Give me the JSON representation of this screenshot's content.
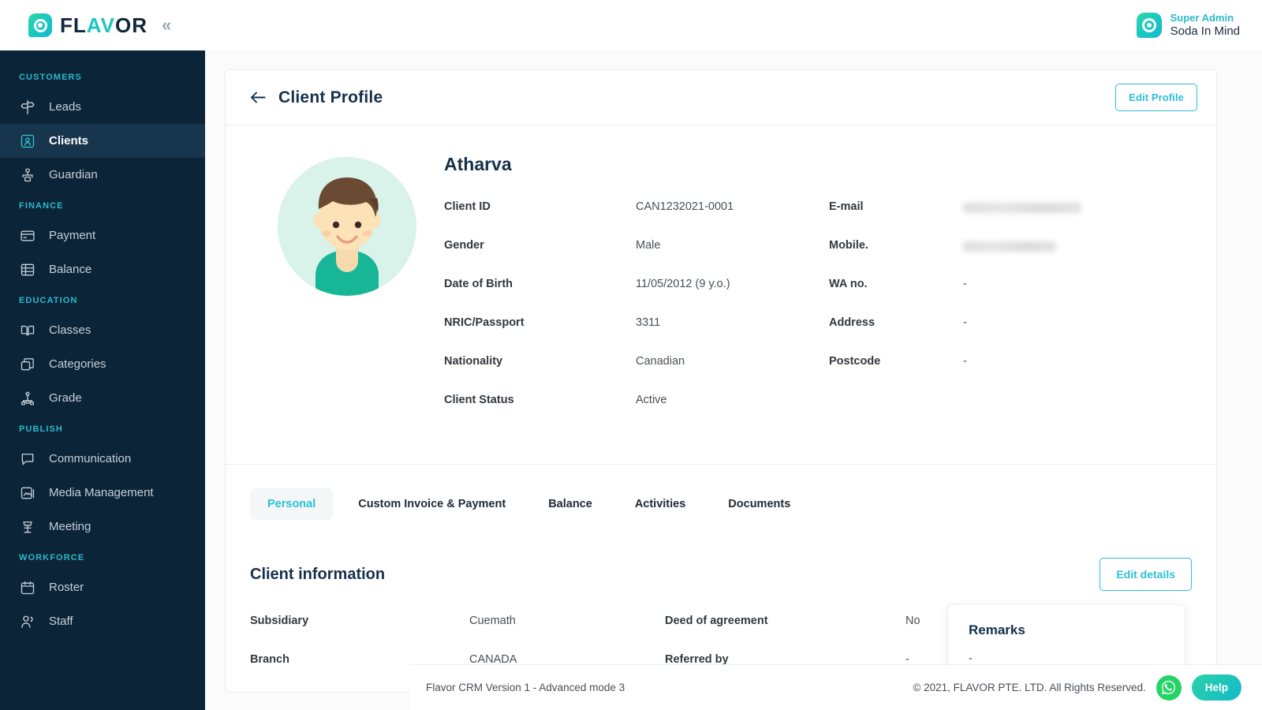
{
  "brand": {
    "logo_text_1": "FL",
    "logo_text_a": "A",
    "logo_text_v": "V",
    "logo_text_2": "OR",
    "collapse_icon": "«",
    "accent": "#2cc6d6",
    "sidebar_bg": "#0b2437",
    "active_bg": "#17354c"
  },
  "topbar": {
    "role": "Super Admin",
    "name": "Soda In Mind"
  },
  "sidebar": {
    "sections": [
      {
        "label": "CUSTOMERS",
        "items": [
          {
            "label": "Leads",
            "icon": "signpost-icon",
            "active": false
          },
          {
            "label": "Clients",
            "icon": "client-card-icon",
            "active": true
          },
          {
            "label": "Guardian",
            "icon": "guardian-icon",
            "active": false
          }
        ]
      },
      {
        "label": "FINANCE",
        "items": [
          {
            "label": "Payment",
            "icon": "credit-card-icon",
            "active": false
          },
          {
            "label": "Balance",
            "icon": "coins-stack-icon",
            "active": false
          }
        ]
      },
      {
        "label": "EDUCATION",
        "items": [
          {
            "label": "Classes",
            "icon": "open-book-icon",
            "active": false
          },
          {
            "label": "Categories",
            "icon": "boxes-icon",
            "active": false
          },
          {
            "label": "Grade",
            "icon": "hierarchy-icon",
            "active": false
          }
        ]
      },
      {
        "label": "PUBLISH",
        "items": [
          {
            "label": "Communication",
            "icon": "chat-bubble-icon",
            "active": false
          },
          {
            "label": "Media Management",
            "icon": "image-icon",
            "active": false
          },
          {
            "label": "Meeting",
            "icon": "podium-icon",
            "active": false
          }
        ]
      },
      {
        "label": "WORKFORCE",
        "items": [
          {
            "label": "Roster",
            "icon": "calendar-icon",
            "active": false
          },
          {
            "label": "Staff",
            "icon": "people-icon",
            "active": false
          }
        ]
      }
    ]
  },
  "page": {
    "title": "Client Profile",
    "back_icon": "arrow-left-icon",
    "edit_profile_label": "Edit Profile"
  },
  "client": {
    "name": "Atharva",
    "avatar": "boy-avatar",
    "left_fields": [
      {
        "label": "Client ID",
        "value": "CAN1232021-0001"
      },
      {
        "label": "Gender",
        "value": "Male"
      },
      {
        "label": "Date of Birth",
        "value": "11/05/2012 (9 y.o.)"
      },
      {
        "label": "NRIC/Passport",
        "value": "3311"
      },
      {
        "label": "Nationality",
        "value": "Canadian"
      },
      {
        "label": "Client Status",
        "value": "Active"
      }
    ],
    "right_fields": [
      {
        "label": "E-mail",
        "value": "",
        "redacted": "email"
      },
      {
        "label": "Mobile.",
        "value": "",
        "redacted": "mobile"
      },
      {
        "label": "WA no.",
        "value": "-",
        "redacted": ""
      },
      {
        "label": "Address",
        "value": "-",
        "redacted": ""
      },
      {
        "label": "Postcode",
        "value": "-",
        "redacted": ""
      }
    ]
  },
  "tabs": [
    {
      "label": "Personal",
      "active": true
    },
    {
      "label": "Custom Invoice & Payment",
      "active": false
    },
    {
      "label": "Balance",
      "active": false
    },
    {
      "label": "Activities",
      "active": false
    },
    {
      "label": "Documents",
      "active": false
    }
  ],
  "client_information": {
    "title": "Client information",
    "edit_details_label": "Edit details",
    "rows": [
      {
        "label": "Subsidiary",
        "value": "Cuemath",
        "label2": "Deed of agreement",
        "value2": "No"
      },
      {
        "label": "Branch",
        "value": "CANADA",
        "label2": "Referred by",
        "value2": "-"
      }
    ]
  },
  "remarks": {
    "title": "Remarks",
    "value": "-"
  },
  "footer": {
    "version": "Flavor CRM Version 1 - Advanced mode 3",
    "copyright": "© 2021, FLAVOR PTE. LTD. All Rights Reserved.",
    "help_label": "Help",
    "whatsapp_icon": "whatsapp-icon"
  }
}
